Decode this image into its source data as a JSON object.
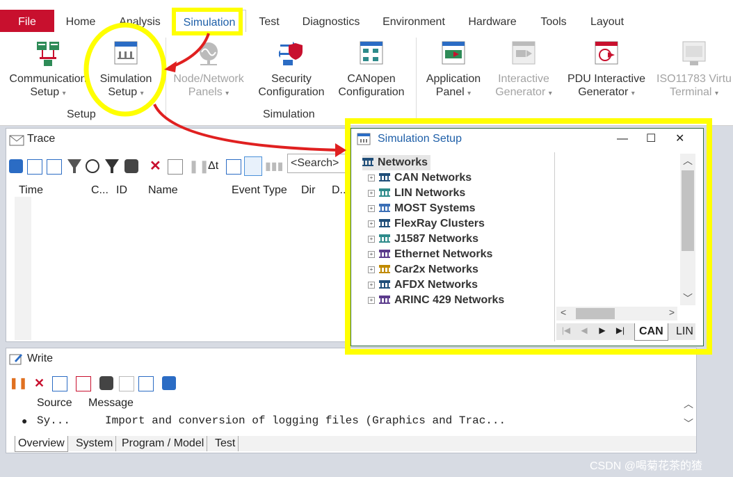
{
  "menu": {
    "tabs": [
      "File",
      "Home",
      "Analysis",
      "Simulation",
      "Test",
      "Diagnostics",
      "Environment",
      "Hardware",
      "Tools",
      "Layout"
    ]
  },
  "ribbon": {
    "communication_setup": [
      "Communication",
      "Setup"
    ],
    "simulation_setup": [
      "Simulation",
      "Setup"
    ],
    "node_network_panels": [
      "Node/Network",
      "Panels"
    ],
    "security_configuration": [
      "Security",
      "Configuration"
    ],
    "canopen_configuration": [
      "CANopen",
      "Configuration"
    ],
    "application_panel": [
      "Application",
      "Panel"
    ],
    "interactive_generator": [
      "Interactive",
      "Generator"
    ],
    "pdu_interactive_generator": [
      "PDU Interactive",
      "Generator"
    ],
    "iso11783": [
      "ISO11783 Virtu",
      "Terminal"
    ],
    "group_setup": "Setup",
    "group_simulation": "Simulation",
    "dropdown_caret": "▾"
  },
  "trace": {
    "title": "Trace",
    "search_placeholder": "<Search>",
    "columns": [
      "Time",
      "C...",
      "ID",
      "Name",
      "Event Type",
      "Dir",
      "D..."
    ]
  },
  "sim_setup": {
    "title": "Simulation Setup",
    "root": "Networks",
    "items": [
      "CAN Networks",
      "LIN Networks",
      "MOST Systems",
      "FlexRay Clusters",
      "J1587 Networks",
      "Ethernet Networks",
      "Car2x Networks",
      "AFDX Networks",
      "ARINC 429 Networks"
    ],
    "tabs": [
      "CAN",
      "LIN"
    ],
    "window_controls": [
      "—",
      "☐",
      "✕"
    ],
    "icon_colors": [
      "#1f4e79",
      "#2e8b8b",
      "#3b6fb6",
      "#1f4e79",
      "#2e8b8b",
      "#5b3b8c",
      "#c08a00",
      "#1f4e79",
      "#5b3b8c"
    ]
  },
  "write": {
    "title": "Write",
    "columns": [
      "Source",
      "Message"
    ],
    "row": {
      "source": "Sy...",
      "message": "Import and conversion of logging files (Graphics and Trac..."
    },
    "tabs": [
      "Overview",
      "System",
      "Program / Model",
      "Test"
    ]
  },
  "watermark": "CSDN @喝菊花茶的猹",
  "colors": {
    "accent": "#1e5fa8",
    "file_red": "#c8102e",
    "highlight": "#ffff00",
    "arrow": "#e02020"
  }
}
